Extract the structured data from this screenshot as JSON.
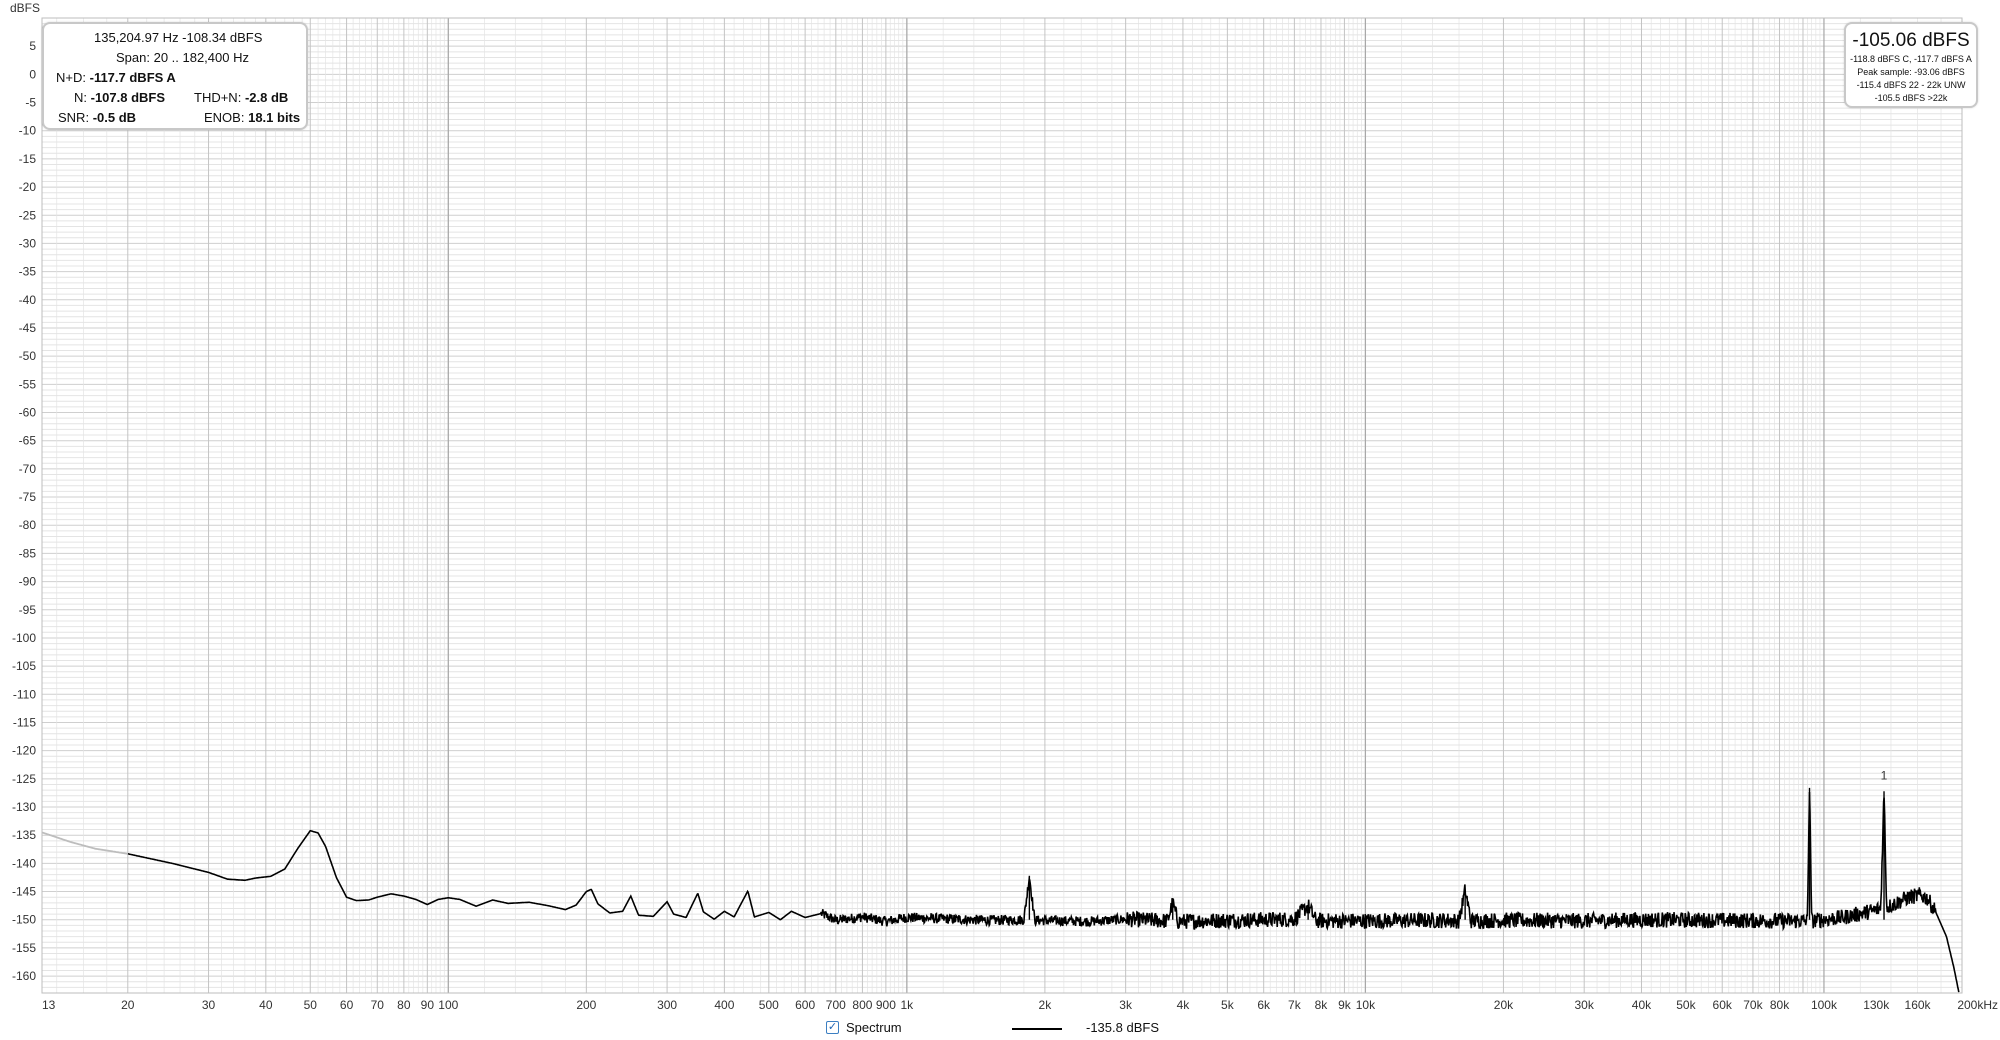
{
  "chart_data": {
    "type": "line",
    "title": "",
    "xlabel": "",
    "ylabel": "dBFS",
    "x_unit": "kHz",
    "x_scale": "log",
    "xlim": [
      13,
      200000
    ],
    "ylim": [
      -163,
      10
    ],
    "grid": true,
    "y_ticks": [
      5,
      0,
      -5,
      -10,
      -15,
      -20,
      -25,
      -30,
      -35,
      -40,
      -45,
      -50,
      -55,
      -60,
      -65,
      -70,
      -75,
      -80,
      -85,
      -90,
      -95,
      -100,
      -105,
      -110,
      -115,
      -120,
      -125,
      -130,
      -135,
      -140,
      -145,
      -150,
      -155,
      -160
    ],
    "x_ticks": [
      {
        "value": 13,
        "label": "13"
      },
      {
        "value": 20,
        "label": "20"
      },
      {
        "value": 30,
        "label": "30"
      },
      {
        "value": 40,
        "label": "40"
      },
      {
        "value": 50,
        "label": "50"
      },
      {
        "value": 60,
        "label": "60"
      },
      {
        "value": 70,
        "label": "70"
      },
      {
        "value": 80,
        "label": "80"
      },
      {
        "value": 90,
        "label": "90"
      },
      {
        "value": 100,
        "label": "100"
      },
      {
        "value": 200,
        "label": "200"
      },
      {
        "value": 300,
        "label": "300"
      },
      {
        "value": 400,
        "label": "400"
      },
      {
        "value": 500,
        "label": "500"
      },
      {
        "value": 600,
        "label": "600"
      },
      {
        "value": 700,
        "label": "700"
      },
      {
        "value": 800,
        "label": "800"
      },
      {
        "value": 900,
        "label": "900"
      },
      {
        "value": 1000,
        "label": "1k"
      },
      {
        "value": 2000,
        "label": "2k"
      },
      {
        "value": 3000,
        "label": "3k"
      },
      {
        "value": 4000,
        "label": "4k"
      },
      {
        "value": 5000,
        "label": "5k"
      },
      {
        "value": 6000,
        "label": "6k"
      },
      {
        "value": 7000,
        "label": "7k"
      },
      {
        "value": 8000,
        "label": "8k"
      },
      {
        "value": 9000,
        "label": "9k"
      },
      {
        "value": 10000,
        "label": "10k"
      },
      {
        "value": 20000,
        "label": "20k"
      },
      {
        "value": 30000,
        "label": "30k"
      },
      {
        "value": 40000,
        "label": "40k"
      },
      {
        "value": 50000,
        "label": "50k"
      },
      {
        "value": 60000,
        "label": "60k"
      },
      {
        "value": 70000,
        "label": "70k"
      },
      {
        "value": 80000,
        "label": "80k"
      },
      {
        "value": 100000,
        "label": "100k"
      },
      {
        "value": 130000,
        "label": "130k"
      },
      {
        "value": 160000,
        "label": "160k"
      },
      {
        "value": 200000,
        "label": "200kHz"
      }
    ],
    "series": [
      {
        "name": "Spectrum",
        "color": "#000000",
        "points": [
          [
            13,
            -134.5
          ],
          [
            15,
            -136.2
          ],
          [
            17,
            -137.4
          ],
          [
            20,
            -138.3
          ],
          [
            25,
            -140.0
          ],
          [
            30,
            -141.6
          ],
          [
            33,
            -142.8
          ],
          [
            36,
            -143.0
          ],
          [
            38,
            -142.6
          ],
          [
            41,
            -142.3
          ],
          [
            44,
            -141.0
          ],
          [
            47,
            -137.3
          ],
          [
            50,
            -134.2
          ],
          [
            52,
            -134.6
          ],
          [
            54,
            -137.0
          ],
          [
            57,
            -142.5
          ],
          [
            60,
            -146.0
          ],
          [
            63,
            -146.6
          ],
          [
            67,
            -146.5
          ],
          [
            70,
            -146.0
          ],
          [
            75,
            -145.4
          ],
          [
            80,
            -145.8
          ],
          [
            85,
            -146.4
          ],
          [
            90,
            -147.3
          ],
          [
            95,
            -146.4
          ],
          [
            100,
            -146.1
          ],
          [
            106,
            -146.4
          ],
          [
            115,
            -147.6
          ],
          [
            125,
            -146.5
          ],
          [
            135,
            -147.1
          ],
          [
            150,
            -146.9
          ],
          [
            165,
            -147.5
          ],
          [
            180,
            -148.2
          ],
          [
            190,
            -147.4
          ],
          [
            200,
            -145.0
          ],
          [
            205,
            -144.6
          ],
          [
            212,
            -147.2
          ],
          [
            225,
            -148.8
          ],
          [
            240,
            -148.5
          ],
          [
            250,
            -145.8
          ],
          [
            260,
            -149.2
          ],
          [
            280,
            -149.4
          ],
          [
            300,
            -146.8
          ],
          [
            310,
            -149.0
          ],
          [
            330,
            -149.6
          ],
          [
            350,
            -145.3
          ],
          [
            360,
            -148.6
          ],
          [
            380,
            -149.9
          ],
          [
            400,
            -148.5
          ],
          [
            420,
            -149.5
          ],
          [
            450,
            -144.9
          ],
          [
            465,
            -149.5
          ],
          [
            500,
            -148.7
          ],
          [
            530,
            -150.0
          ],
          [
            560,
            -148.5
          ],
          [
            600,
            -149.6
          ],
          [
            650,
            -148.9
          ],
          [
            700,
            -150.1
          ],
          [
            800,
            -149.5
          ],
          [
            900,
            -150.3
          ],
          [
            1000,
            -149.6
          ],
          [
            1500,
            -150.1
          ],
          [
            1800,
            -150.0
          ],
          [
            1850,
            -142.2
          ],
          [
            1900,
            -150.1
          ],
          [
            2500,
            -150.3
          ],
          [
            3000,
            -149.9
          ],
          [
            3700,
            -150.2
          ],
          [
            3800,
            -147.0
          ],
          [
            3900,
            -150.3
          ],
          [
            5000,
            -150.1
          ],
          [
            7000,
            -149.9
          ],
          [
            7500,
            -147.5
          ],
          [
            7800,
            -150.2
          ],
          [
            10000,
            -150.2
          ],
          [
            15000,
            -150.1
          ],
          [
            16000,
            -150.2
          ],
          [
            16500,
            -144.8
          ],
          [
            17000,
            -150.2
          ],
          [
            20000,
            -150.1
          ],
          [
            30000,
            -150.2
          ],
          [
            40000,
            -150.0
          ],
          [
            60000,
            -150.1
          ],
          [
            80000,
            -150.2
          ],
          [
            92000,
            -150.2
          ],
          [
            93000,
            -126.6
          ],
          [
            94000,
            -150.2
          ],
          [
            110000,
            -149.6
          ],
          [
            125000,
            -148.6
          ],
          [
            133000,
            -148.0
          ],
          [
            135200,
            -127.2
          ],
          [
            137000,
            -147.8
          ],
          [
            145000,
            -146.9
          ],
          [
            152000,
            -146.1
          ],
          [
            158000,
            -145.8
          ],
          [
            162000,
            -145.6
          ],
          [
            168000,
            -146.2
          ],
          [
            175000,
            -148.5
          ],
          [
            185000,
            -153.0
          ],
          [
            192000,
            -158.5
          ],
          [
            197000,
            -163.0
          ]
        ]
      }
    ],
    "annotations": [
      {
        "x": 135200,
        "y": -125.8,
        "text": "1"
      }
    ]
  },
  "measurements": {
    "cursor": "135,204.97 Hz  -108.34 dBFS",
    "span": "Span: 20 .. 182,400 Hz",
    "nd_label": "N+D:",
    "nd_value": "-117.7 dBFS A",
    "n_label": "N:",
    "n_value": "-107.8 dBFS",
    "thdn_label": "THD+N:",
    "thdn_value": "-2.8 dB",
    "snr_label": "SNR:",
    "snr_value": "-0.5 dB",
    "enob_label": "ENOB:",
    "enob_value": "18.1 bits"
  },
  "level": {
    "main": "-105.06 dBFS",
    "line1": "-118.8 dBFS C, -117.7 dBFS A",
    "line2": "Peak sample: -93.06 dBFS",
    "line3": "-115.4 dBFS 22 - 22k UNW",
    "line4": "-105.5 dBFS >22k"
  },
  "legend": {
    "label": "Spectrum",
    "value": "-135.8 dBFS"
  },
  "colors": {
    "grid_minor": "#e4e4e4",
    "grid_major": "#a8a8a8",
    "trace": "#000000",
    "trace_low": "#bdbdbd",
    "check": "#1e64b4"
  }
}
